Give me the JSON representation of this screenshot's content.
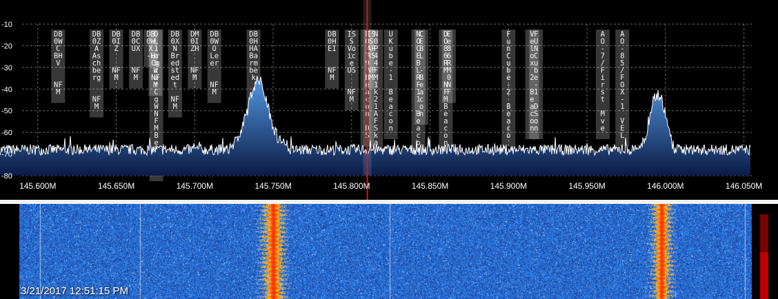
{
  "spectrum": {
    "db_labels": [
      "-10",
      "-20",
      "-30",
      "-40",
      "-50",
      "-60",
      "-70",
      "-80"
    ],
    "db_values": [
      -10,
      -20,
      -30,
      -40,
      -50,
      -60,
      -70,
      -80
    ],
    "freq_labels": [
      "145.600M",
      "145.650M",
      "145.700M",
      "145.750M",
      "145.800M",
      "145.850M",
      "145.900M",
      "145.950M",
      "146.000M",
      "146.050M"
    ],
    "freq_values": [
      145.6,
      145.65,
      145.7,
      145.75,
      145.8,
      145.85,
      145.9,
      145.95,
      146.0,
      146.05
    ],
    "freq_range": [
      145.59,
      146.055
    ],
    "db_range": [
      -10,
      -80
    ],
    "noise_floor_db": -68,
    "tuned_freq": 145.81,
    "colors": {
      "fill_top": "#4f8fd6",
      "fill_bottom": "#0b1b45",
      "trace": "#ffffff",
      "grid": "#6a6a6a",
      "marker": "#d01818"
    }
  },
  "bookmarks": [
    {
      "f": 145.613,
      "text": "DB0WCBHV NFM",
      "lines": [
        "DB",
        "0W",
        "C",
        "BH",
        "V",
        "",
        "",
        "NF",
        "M"
      ]
    },
    {
      "f": 145.6375,
      "text": "DB0ZAAschberg NFM",
      "lines": [
        "DB",
        "0Z",
        "A",
        "As",
        "ch",
        "be",
        "rg",
        "",
        "",
        "NF",
        "M"
      ]
    },
    {
      "f": 145.65,
      "text": "DB0IZ NFM",
      "lines": [
        "DB",
        "0I",
        "Z",
        "",
        "",
        "NF",
        "M"
      ]
    },
    {
      "f": 145.6625,
      "text": "DB0CUX NFM",
      "lines": [
        "DB",
        "0C",
        "UX",
        "",
        "",
        "NF",
        "M"
      ]
    },
    {
      "f": 145.672,
      "text": "DB0WX-H",
      "lines": [
        "DB",
        "0W",
        "X",
        "-H"
      ]
    },
    {
      "f": 145.6755,
      "text": "DL1abzur Cg W NFM Beacon",
      "lines": [
        "D",
        "L",
        "1",
        "a",
        "b",
        "z",
        "u",
        "r",
        "C",
        "g",
        "W",
        "N",
        "F",
        "M",
        "B",
        "e",
        "a",
        "c",
        "o",
        "n"
      ]
    },
    {
      "f": 145.675,
      "text": "OL1burgCgW NFM",
      "lines": [
        "",
        "",
        "",
        "ur",
        "Cg",
        "W",
        "NF",
        "M"
      ]
    },
    {
      "f": 145.6875,
      "text": "DB0XN Bredstedt NFM",
      "lines": [
        "DB",
        "0X",
        "N",
        "Br",
        "ed",
        "st",
        "ed",
        "t",
        "",
        "NF",
        "M"
      ]
    },
    {
      "f": 145.7,
      "text": "DM0IZH NFM",
      "lines": [
        "DM",
        "0I",
        "ZH",
        "",
        "",
        "NF",
        "M"
      ]
    },
    {
      "f": 145.7125,
      "text": "DB0WOLeer NFM",
      "lines": [
        "DB",
        "0W",
        "O",
        "Le",
        "er",
        "",
        "",
        "NF",
        "M"
      ]
    },
    {
      "f": 145.7375,
      "text": "DB0HHABarmbek NFM",
      "lines": [
        "DB",
        "0H",
        "HA",
        "Ba",
        "rm",
        "be",
        "k",
        "",
        "",
        "NF",
        "M"
      ]
    },
    {
      "f": 145.7875,
      "text": "DB0HEI NFM",
      "lines": [
        "DB",
        "0H",
        "EI",
        "",
        "",
        "NF",
        "M"
      ]
    },
    {
      "f": 145.8,
      "text": "ISS Voice US NFM",
      "lines": [
        "IS",
        "S",
        "Vo",
        "ic",
        "e",
        "US",
        "",
        "",
        "NF",
        "M"
      ]
    },
    {
      "f": 145.81,
      "text": "EO-79 Beacon DS",
      "lines": [
        "E",
        "O",
        "-",
        "7",
        "9",
        "",
        "B",
        "e",
        "a",
        "c",
        "o",
        "n",
        "",
        "D",
        "S"
      ]
    },
    {
      "f": 145.8125,
      "text": "ISS APRS",
      "lines": [
        "IS",
        "S",
        "AP",
        "RS",
        "",
        "NF",
        "M"
      ]
    },
    {
      "f": 145.8155,
      "text": "N 0 4 4 2 1 1 k 2 1 A F S k a",
      "lines": [
        "N",
        "0",
        "P",
        "4",
        "4",
        "F",
        "M",
        "1",
        "k",
        "2",
        "1",
        "A",
        "F",
        "S",
        "k",
        "a"
      ]
    },
    {
      "f": 145.825,
      "text": "UKube-1 Beacon",
      "lines": [
        "U",
        "K",
        "u",
        "b",
        "e",
        "-",
        "1",
        "",
        "B",
        "e",
        "a",
        "c",
        "o",
        "n"
      ]
    },
    {
      "f": 145.8425,
      "text": "NOCEBLRF11 BeaconDS",
      "lines": [
        "N",
        "O",
        "C",
        "E",
        "B",
        "L",
        "R",
        "F",
        "1",
        "1",
        "",
        "B",
        "e",
        "a",
        "c",
        "o",
        "n",
        "D",
        "S"
      ]
    },
    {
      "f": 145.8445,
      "text": "CL-1 Beacon",
      "lines": [
        "C",
        "E",
        "B",
        "L",
        "",
        "-",
        "B",
        "e",
        "a",
        "c",
        "o",
        "n"
      ]
    },
    {
      "f": 145.86,
      "text": "DO 86 RM NFM Beacon DS",
      "lines": [
        "D",
        "O",
        "8",
        "6",
        "R",
        "M",
        "",
        "N",
        "F",
        "M",
        "B",
        "e",
        "a",
        "c",
        "o",
        "n",
        "",
        "D",
        "S"
      ]
    },
    {
      "f": 145.862,
      "text": "E0 86 RM",
      "lines": [
        "E",
        "e",
        "8",
        "6",
        "R",
        "M",
        "0",
        "N",
        "F"
      ]
    },
    {
      "f": 145.9,
      "text": "FunCube-2 Beaco",
      "lines": [
        "F",
        "u",
        "n",
        "C",
        "u",
        "b",
        "e",
        "-",
        "2",
        "",
        "B",
        "e",
        "a",
        "c",
        "o"
      ]
    },
    {
      "f": 145.915,
      "text": "Velox2 Beacon",
      "lines": [
        "V",
        "e",
        "l",
        "o",
        "x",
        "",
        "2",
        "",
        "B",
        "e",
        "a",
        "c",
        "o",
        "n"
      ]
    },
    {
      "f": 145.9175,
      "text": "FUNCube-1 DS Beacon",
      "lines": [
        "F",
        "U",
        "N",
        "C",
        "u",
        "b",
        "e",
        "-",
        "1",
        "",
        "D",
        "S",
        "o",
        "n"
      ]
    },
    {
      "f": 145.96,
      "text": "AO-7/First Move",
      "lines": [
        "A",
        "O",
        "-",
        "7",
        "/",
        "F",
        "i",
        "r",
        "s",
        "t",
        "",
        "M",
        "v",
        "e"
      ]
    },
    {
      "f": 145.9725,
      "text": "AO-85/FOX-1 VEL",
      "lines": [
        "A",
        "O",
        "-",
        "8",
        "5",
        "/",
        "F",
        "O",
        "X",
        "-",
        "1",
        "",
        "V",
        "E",
        "L"
      ]
    }
  ],
  "signals": [
    {
      "center": 145.75,
      "width": 0.0255,
      "peak_db": -39
    },
    {
      "center": 145.9975,
      "width": 0.022,
      "peak_db": -45
    }
  ],
  "waterfall": {
    "timestamp": "3/21/2017 12:51:15 PM",
    "colors": {
      "low": "#1a3f9a",
      "mid": "#3d6fd8",
      "hot": "#ff9a00",
      "core": "#ff2a00",
      "level_bar": "#7a0000"
    }
  }
}
